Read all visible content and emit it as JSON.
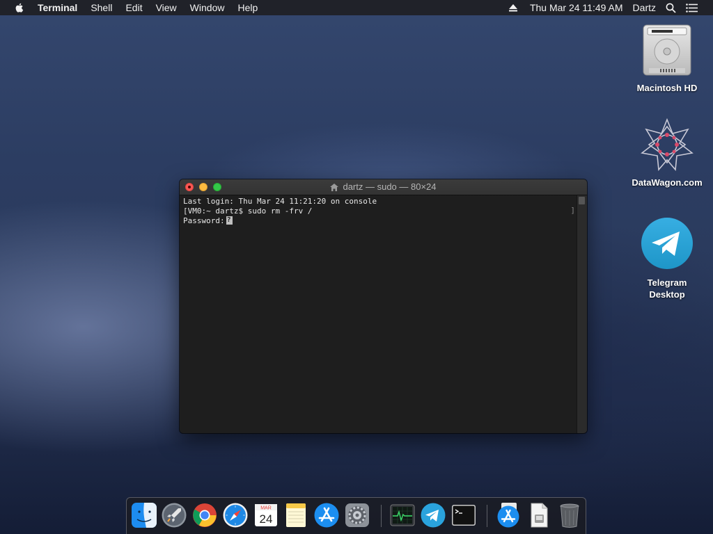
{
  "menubar": {
    "apple_icon": "apple-logo-icon",
    "app_name": "Terminal",
    "menus": [
      "Shell",
      "Edit",
      "View",
      "Window",
      "Help"
    ],
    "clock": "Thu Mar 24  11:49 AM",
    "user": "Dartz"
  },
  "desktop_icons": [
    {
      "label": "Macintosh HD",
      "icon": "hard-drive-icon"
    },
    {
      "label": "DataWagon.com",
      "icon": "datawagon-icon"
    },
    {
      "label": "Telegram Desktop",
      "icon": "telegram-icon"
    }
  ],
  "terminal": {
    "title": "dartz — sudo — 80×24",
    "lines": [
      "Last login: Thu Mar 24 11:21:20 on console",
      "[VM0:~ dartz$ sudo rm -frv /",
      "Password:"
    ]
  },
  "dock": {
    "items": [
      {
        "name": "Finder",
        "icon": "finder-icon",
        "running": true
      },
      {
        "name": "Launchpad",
        "icon": "launchpad-icon",
        "running": false
      },
      {
        "name": "Google Chrome",
        "icon": "chrome-icon",
        "running": true
      },
      {
        "name": "Safari",
        "icon": "safari-icon",
        "running": true
      },
      {
        "name": "Calendar",
        "icon": "calendar-icon",
        "running": false,
        "month": "MAR",
        "day": "24"
      },
      {
        "name": "Notes",
        "icon": "notes-icon",
        "running": false
      },
      {
        "name": "App Store",
        "icon": "app-store-icon",
        "running": false
      },
      {
        "name": "System Preferences",
        "icon": "system-preferences-icon",
        "running": false
      },
      {
        "name": "Activity Monitor",
        "icon": "activity-monitor-icon",
        "running": true
      },
      {
        "name": "Telegram",
        "icon": "telegram-icon",
        "running": false
      },
      {
        "name": "Terminal",
        "icon": "terminal-icon",
        "running": true
      },
      {
        "name": "App Store Downloads",
        "icon": "app-store-icon",
        "running": false
      },
      {
        "name": "Document",
        "icon": "document-icon",
        "running": false
      },
      {
        "name": "Trash",
        "icon": "trash-icon",
        "running": false
      }
    ]
  }
}
